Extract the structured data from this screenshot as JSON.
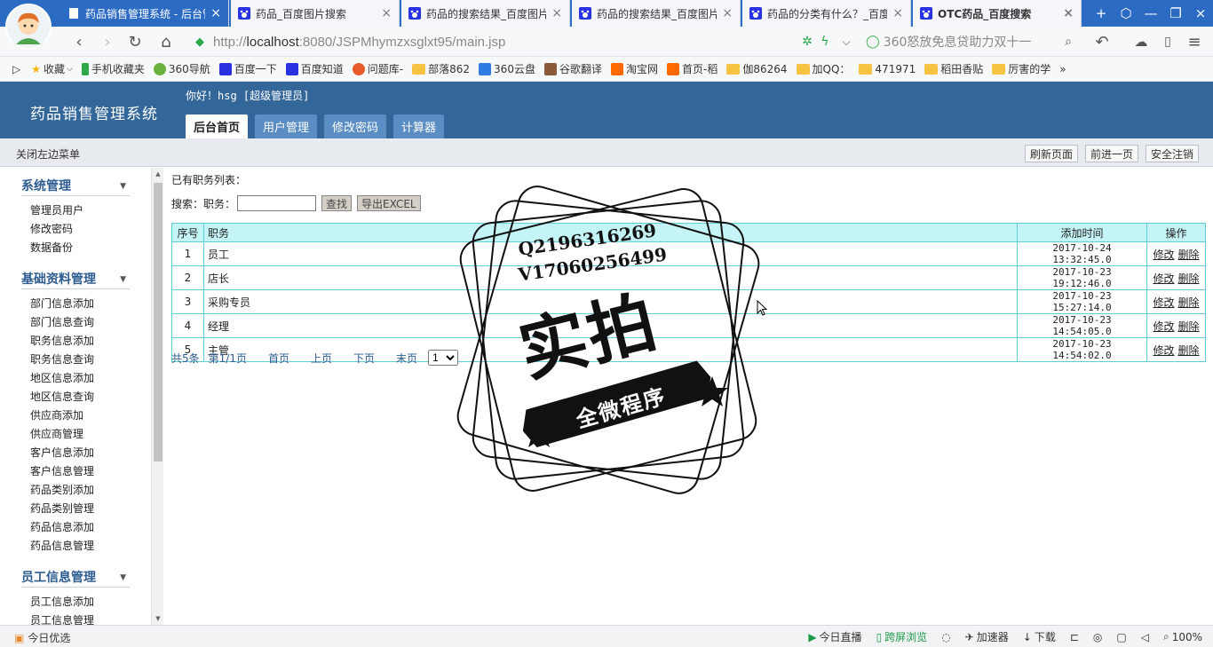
{
  "browser": {
    "tabs": [
      {
        "title": "药品销售管理系统 - 后台管理",
        "active": true
      },
      {
        "title": "药品_百度图片搜索",
        "active": false
      },
      {
        "title": "药品的搜索结果_百度图片搜索",
        "active": false
      },
      {
        "title": "药品的搜索结果_百度图片搜索",
        "active": false
      },
      {
        "title": "药品的分类有什么？_百度知道",
        "active": false
      },
      {
        "title": "OTC药品_百度搜索",
        "active": false
      }
    ],
    "url_prefix": "http://",
    "url_host": "localhost",
    "url_path": ":8080/JSPMhymzxsglxt95/main.jsp",
    "search_hint": "360怒放免息贷助力双十一",
    "bookmarks": [
      "收藏",
      "手机收藏夹",
      "360导航",
      "百度一下",
      "百度知道",
      "问题库-",
      "部落862",
      "360云盘",
      "谷歌翻译",
      "淘宝网",
      "首页-稻",
      "伽86264",
      "加QQ：",
      "471971",
      "稻田香贴",
      "厉害的学"
    ]
  },
  "app": {
    "title": "药品销售管理系统",
    "greeting": "你好！hsg [超级管理员]",
    "nav_tabs": [
      "后台首页",
      "用户管理",
      "修改密码",
      "计算器"
    ],
    "toggle_menu": "关闭左边菜单",
    "right_buttons": [
      "刷新页面",
      "前进一页",
      "安全注销"
    ]
  },
  "sidebar": {
    "groups": [
      {
        "title": "系统管理",
        "items": [
          "管理员用户",
          "修改密码",
          "数据备份"
        ]
      },
      {
        "title": "基础资料管理",
        "items": [
          "部门信息添加",
          "部门信息查询",
          "职务信息添加",
          "职务信息查询",
          "地区信息添加",
          "地区信息查询",
          "供应商添加",
          "供应商管理",
          "客户信息添加",
          "客户信息管理",
          "药品类别添加",
          "药品类别管理",
          "药品信息添加",
          "药品信息管理"
        ]
      },
      {
        "title": "员工信息管理",
        "items": [
          "员工信息添加",
          "员工信息管理"
        ]
      }
    ]
  },
  "main": {
    "list_title": "已有职务列表：",
    "search_label": "搜索：职务：",
    "search_value": "",
    "search_button": "查找",
    "export_button": "导出EXCEL",
    "columns": [
      "序号",
      "职务",
      "添加时间",
      "操作"
    ],
    "rows": [
      {
        "no": "1",
        "title": "员工",
        "time": "2017-10-24 13:32:45.0"
      },
      {
        "no": "2",
        "title": "店长",
        "time": "2017-10-23 19:12:46.0"
      },
      {
        "no": "3",
        "title": "采购专员",
        "time": "2017-10-23 15:27:14.0"
      },
      {
        "no": "4",
        "title": "经理",
        "time": "2017-10-23 14:54:05.0"
      },
      {
        "no": "5",
        "title": "主管",
        "time": "2017-10-23 14:54:02.0"
      }
    ],
    "edit_label": "修改",
    "delete_label": "删除",
    "pager": {
      "total": "共5条",
      "page": "第1/1页",
      "first": "首页",
      "prev": "上页",
      "next": "下页",
      "last": "末页",
      "selected": "1"
    }
  },
  "watermark": {
    "line1": "Q2196316269",
    "line2": "V17060256499",
    "big": "实拍",
    "banner": "全微程序"
  },
  "statusbar": {
    "today": "今日优选",
    "items": [
      "今日直播",
      "跨屏浏览",
      "加速器",
      "下载"
    ],
    "zoom": "100%"
  }
}
